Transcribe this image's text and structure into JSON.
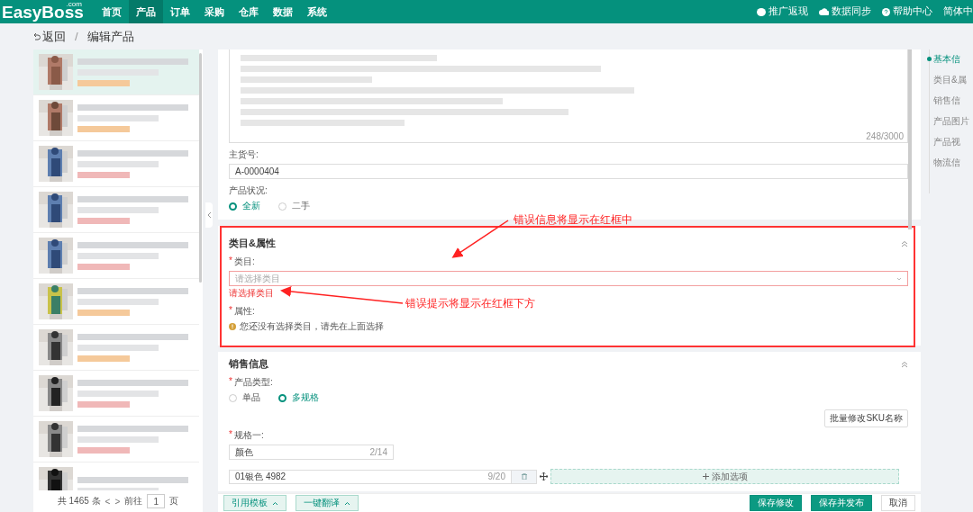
{
  "header": {
    "logo": "EasyBoss",
    "logo_suffix": ".com",
    "nav": [
      {
        "label": "首页",
        "selected": false
      },
      {
        "label": "产品",
        "selected": true
      },
      {
        "label": "订单",
        "selected": false
      },
      {
        "label": "采购",
        "selected": false
      },
      {
        "label": "仓库",
        "selected": false
      },
      {
        "label": "数据",
        "selected": false
      },
      {
        "label": "系统",
        "selected": false
      }
    ],
    "actions": [
      {
        "label": "推广返现"
      },
      {
        "label": "数据同步"
      },
      {
        "label": "帮助中心"
      }
    ],
    "language": "简体中"
  },
  "breadcrumb": {
    "back": "返回",
    "separator": "/",
    "current": "编辑产品"
  },
  "product_list": {
    "items": [
      {
        "kind": "picture",
        "selected": true
      },
      {
        "kind": "picture",
        "selected": false
      },
      {
        "kind": "picture",
        "selected": false
      },
      {
        "kind": "picture",
        "selected": false
      },
      {
        "kind": "picture",
        "selected": false
      },
      {
        "kind": "picture",
        "selected": false
      },
      {
        "kind": "picture",
        "selected": false
      },
      {
        "kind": "picture",
        "selected": false
      },
      {
        "kind": "picture",
        "selected": false
      },
      {
        "kind": "picture",
        "selected": false
      }
    ],
    "footer": {
      "total": "共 1465 条",
      "prev": "<",
      "next": ">",
      "goto": "前往",
      "page": "1",
      "page_unit": "页"
    }
  },
  "basic": {
    "description_count": "248/3000",
    "sku": {
      "label": "主货号:",
      "value": "A-0000404"
    },
    "condition": {
      "label": "产品状况:",
      "options": [
        {
          "label": "全新",
          "selected": true
        },
        {
          "label": "二手",
          "selected": false
        }
      ]
    }
  },
  "category_section": {
    "title": "类目&属性",
    "category": {
      "mark": "*",
      "label": "类目:",
      "placeholder": "请选择类目",
      "error": "请选择类目"
    },
    "attributes": {
      "mark": "*",
      "label": "属性:",
      "hint": "您还没有选择类目，请先在上面选择"
    }
  },
  "sales_section": {
    "title": "销售信息",
    "type": {
      "mark": "*",
      "label": "产品类型:",
      "options": [
        {
          "label": "单品",
          "selected": false
        },
        {
          "label": "多规格",
          "selected": true
        }
      ]
    },
    "batch_button": "批量修改SKU名称",
    "spec": {
      "mark": "*",
      "label": "规格一:",
      "value": "颜色",
      "count": "2/14"
    },
    "option": {
      "value": "01银色 4982",
      "count": "9/20"
    },
    "add_option": "添加选项"
  },
  "bottom_bar": {
    "left": [
      "引用模板",
      "一键翻译"
    ],
    "right": [
      {
        "label": "保存修改",
        "kind": "primary"
      },
      {
        "label": "保存并发布",
        "kind": "primary"
      },
      {
        "label": "取消",
        "kind": "default"
      }
    ]
  },
  "side_nav": [
    {
      "label": "基本信",
      "selected": true
    },
    {
      "label": "类目&属",
      "selected": false
    },
    {
      "label": "销售信",
      "selected": false
    },
    {
      "label": "产品图片",
      "selected": false
    },
    {
      "label": "产品视",
      "selected": false
    },
    {
      "label": "物流信",
      "selected": false
    }
  ],
  "annotations": [
    {
      "text": "错误信息将显示在红框中"
    },
    {
      "text": "错误提示将显示在红框下方"
    }
  ]
}
